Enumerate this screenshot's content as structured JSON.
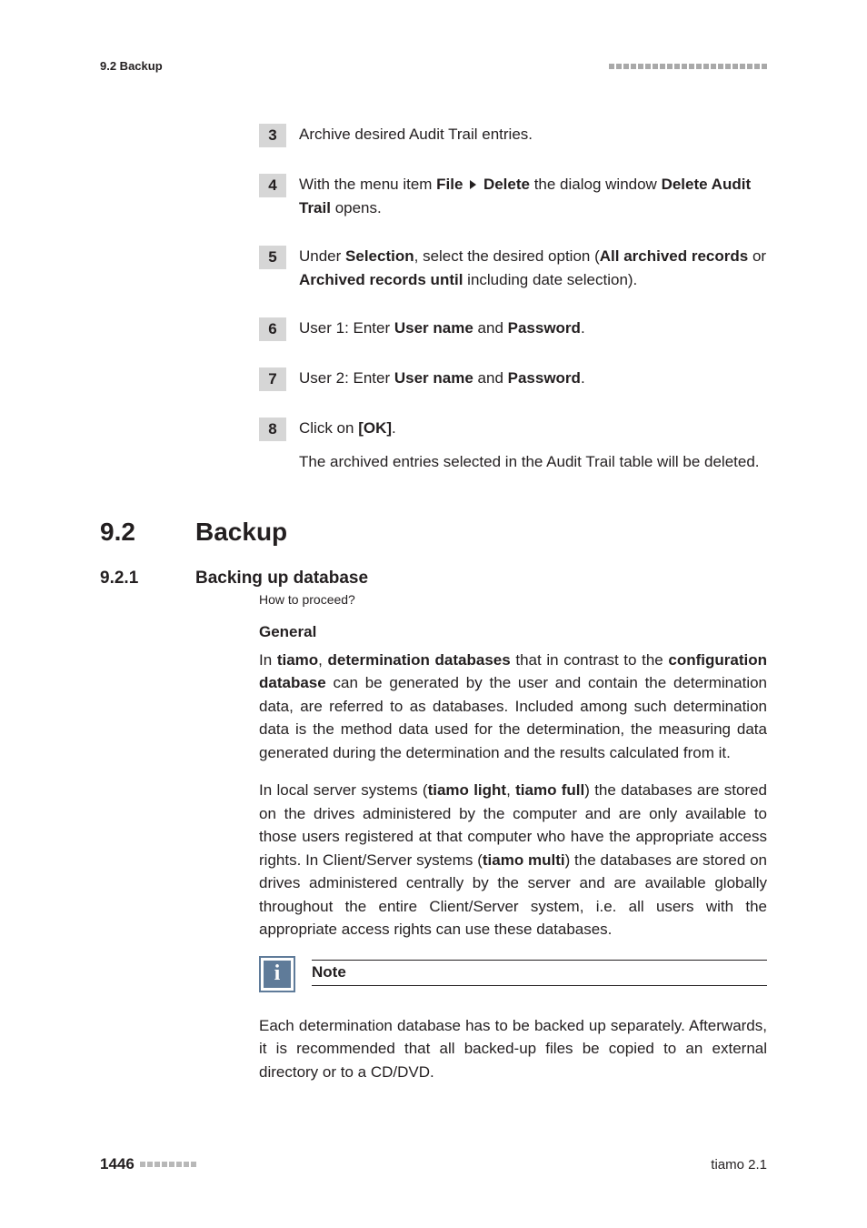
{
  "running_head": {
    "left": "9.2 Backup"
  },
  "steps": [
    {
      "num": "3",
      "body_html": "Archive desired Audit Trail entries."
    },
    {
      "num": "4",
      "body_html": "With the menu item <b>File</b> <span class='tri'></span> <b>Delete</b> the dialog window <b>Delete Audit Trail</b> opens."
    },
    {
      "num": "5",
      "body_html": "Under <b>Selection</b>, select the desired option (<b>All archived records</b> or <b>Archived records until</b> including date selection)."
    },
    {
      "num": "6",
      "body_html": "User 1: Enter <b>User name</b> and <b>Password</b>."
    },
    {
      "num": "7",
      "body_html": "User 2: Enter <b>User name</b> and <b>Password</b>."
    },
    {
      "num": "8",
      "body_html": "Click on <b>[OK]</b>."
    }
  ],
  "result_line": "The archived entries selected in the Audit Trail table will be deleted.",
  "chapter": {
    "num": "9.2",
    "title": "Backup"
  },
  "section": {
    "num": "9.2.1",
    "title": "Backing up database"
  },
  "howto": "How to proceed?",
  "general": {
    "heading": "General",
    "p1_html": "In <b>tiamo</b>, <b>determination databases</b> that in contrast to the <b>configuration database</b> can be generated by the user and contain the determination data, are referred to as databases. Included among such determination data is the method data used for the determination, the measuring data generated during the determination and the results calculated from it.",
    "p2_html": "In local server systems (<b>tiamo light</b>, <b>tiamo full</b>) the databases are stored on the drives administered by the computer and are only available to those users registered at that computer who have the appropriate access rights. In Client/Server systems (<b>tiamo multi</b>) the databases are stored on drives administered centrally by the server and are available globally throughout the entire Client/Server system, i.e. all users with the appropriate access rights can use these databases."
  },
  "note": {
    "title": "Note",
    "body": "Each determination database has to be backed up separately. Afterwards, it is recommended that all backed-up files be copied to an external directory or to a CD/DVD."
  },
  "footer": {
    "page": "1446",
    "right": "tiamo 2.1"
  }
}
